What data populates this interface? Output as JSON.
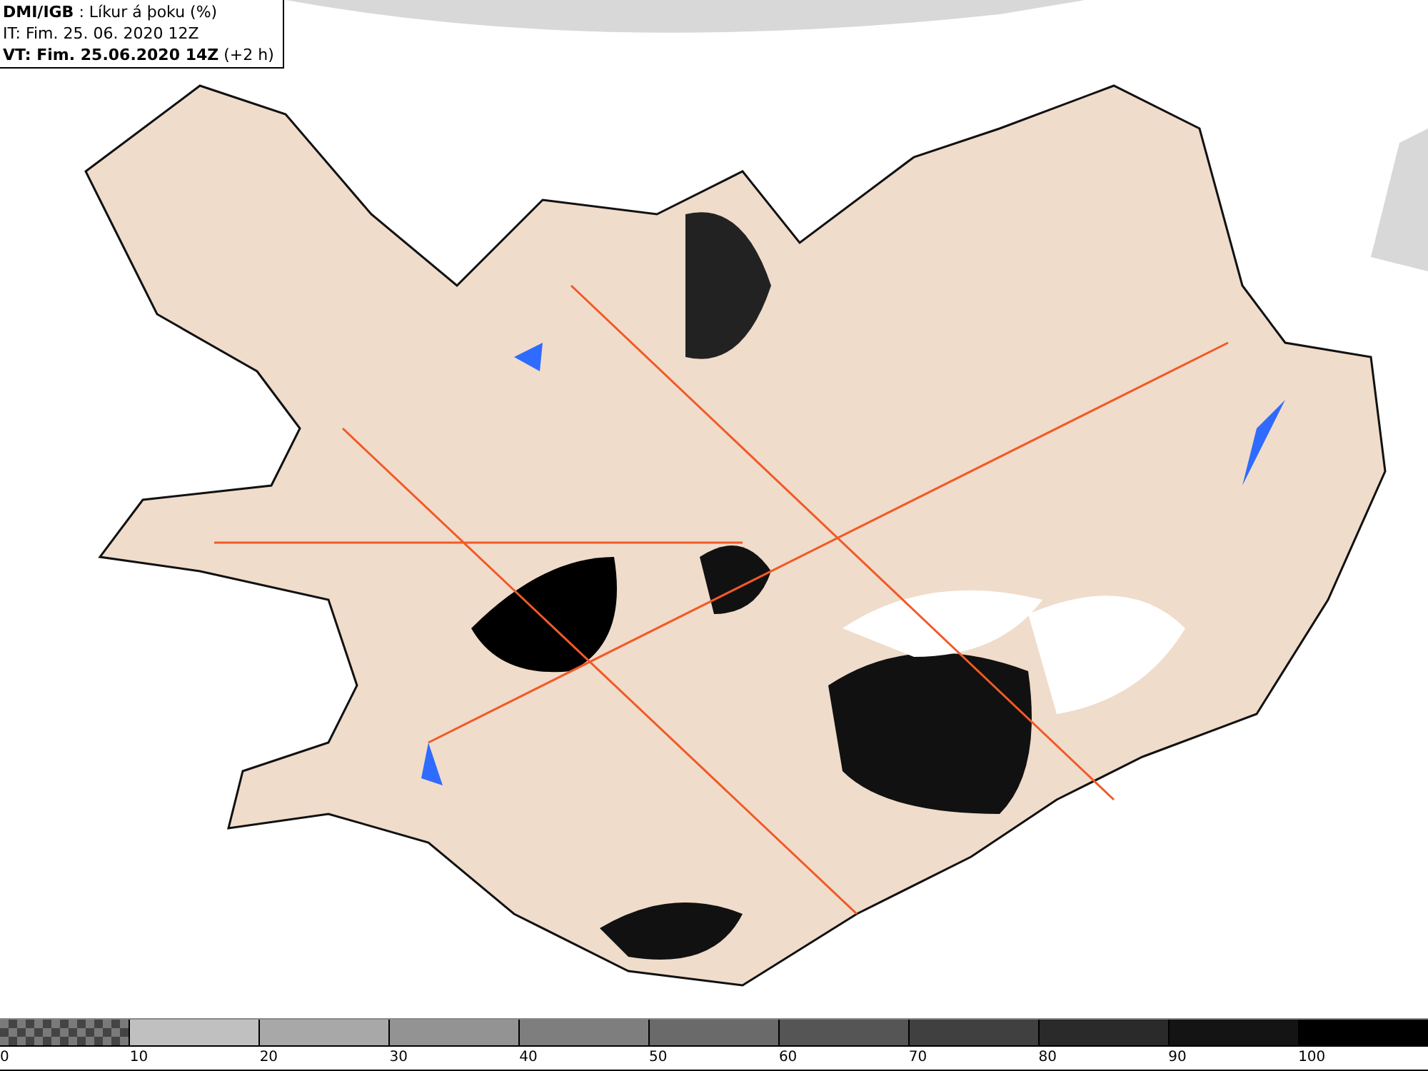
{
  "header": {
    "lines": [
      "**DMI/IGB** : Líkur á þoku (%)",
      "IT: Fim. 25. 06. 2020 12Z",
      "**VT: Fim. 25.06.2020 14Z** (+2 h)"
    ]
  },
  "legend": {
    "segments": [
      {
        "kind": "checker",
        "color": "#7a7a7a"
      },
      {
        "kind": "solid",
        "color": "#c0c0c0"
      },
      {
        "kind": "solid",
        "color": "#a8a8a8"
      },
      {
        "kind": "solid",
        "color": "#939393"
      },
      {
        "kind": "solid",
        "color": "#7e7e7e"
      },
      {
        "kind": "solid",
        "color": "#6a6a6a"
      },
      {
        "kind": "solid",
        "color": "#555555"
      },
      {
        "kind": "solid",
        "color": "#404040"
      },
      {
        "kind": "solid",
        "color": "#2a2a2a"
      },
      {
        "kind": "solid",
        "color": "#141414"
      },
      {
        "kind": "solid",
        "color": "#000000"
      }
    ],
    "labels": [
      "0",
      "10",
      "20",
      "30",
      "40",
      "50",
      "60",
      "70",
      "80",
      "90",
      "100"
    ]
  }
}
